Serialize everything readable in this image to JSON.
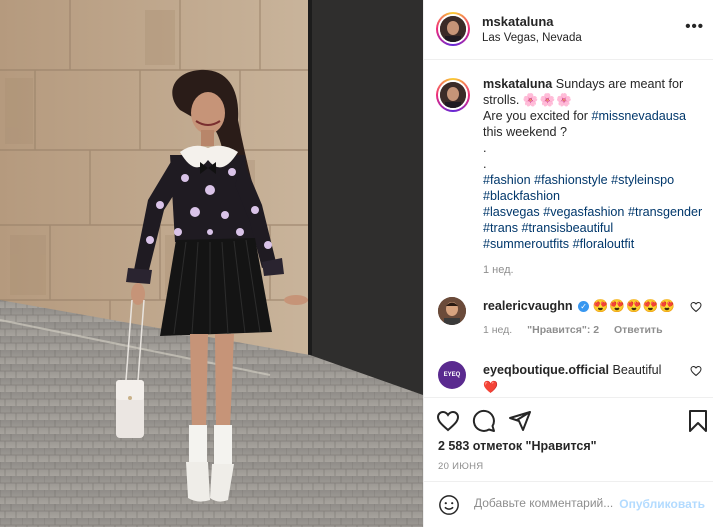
{
  "post": {
    "username": "mskataluna",
    "location": "Las Vegas, Nevada",
    "more_label": "•••"
  },
  "caption": {
    "username": "mskataluna",
    "line1": "Sundays are meant for strolls.",
    "flowers": "🌸🌸🌸",
    "line2_pre": "Are you excited for ",
    "line2_tag": "#missnevadausa",
    "line3": "this weekend ?",
    "dot1": ".",
    "dot2": ".",
    "hashtags": [
      "#fashion",
      "#fashionstyle",
      "#styleinspo",
      "#blackfashion",
      "#lasvegas",
      "#vegasfashion",
      "#transgender",
      "#trans",
      "#transisbeautiful",
      "#summeroutfits",
      "#floraloutfit"
    ],
    "time": "1 нед."
  },
  "comments": [
    {
      "username": "realericvaughn",
      "text": "😍😍😍😍😍",
      "time": "1 нед.",
      "likes": "\"Нравится\": 2",
      "reply": "Ответить",
      "verified": true
    },
    {
      "username": "eyeqboutique.official",
      "text": "Beautiful",
      "heart": "❤️",
      "avatar_text": "EYEQ BOUTIQUE"
    }
  ],
  "stats": {
    "likes": "2 583 отметок \"Нравится\"",
    "date": "20 ИЮНЯ"
  },
  "add_comment": {
    "placeholder": "Добавьте комментарий...",
    "publish": "Опубликовать"
  },
  "colors": {
    "hashtag": "#00376b",
    "publish_disabled": "#b3dbff",
    "verified": "#3897f0",
    "meta_gray": "#8e8e8e"
  },
  "icons": [
    "heart-icon",
    "comment-icon",
    "share-icon",
    "bookmark-icon",
    "emoji-icon",
    "more-icon",
    "verified-icon"
  ]
}
